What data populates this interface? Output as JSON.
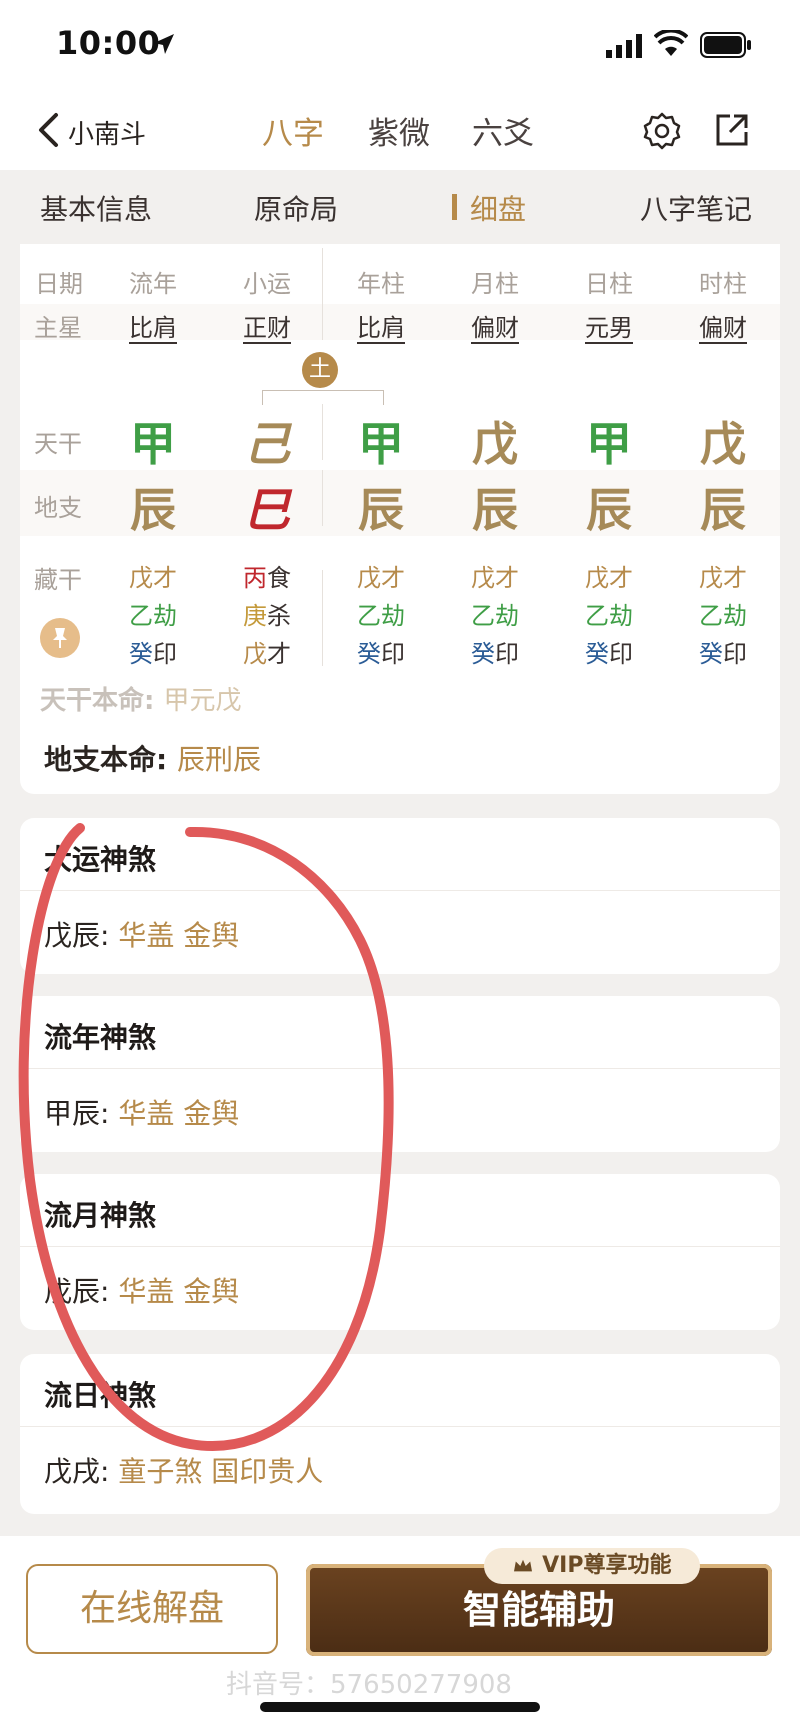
{
  "status": {
    "time": "10:00"
  },
  "nav": {
    "back_label": "小南斗",
    "tabs": [
      {
        "label": "八字"
      },
      {
        "label": "紫微"
      },
      {
        "label": "六爻"
      }
    ]
  },
  "subtabs": [
    {
      "label": "基本信息"
    },
    {
      "label": "原命局"
    },
    {
      "label": "细盘"
    },
    {
      "label": "八字笔记"
    }
  ],
  "chart": {
    "headers": [
      "日期",
      "流年",
      "小运",
      "年柱",
      "月柱",
      "日柱",
      "时柱"
    ],
    "star_label": "主星",
    "stars": [
      "比肩",
      "正财",
      "比肩",
      "偏财",
      "元男",
      "偏财"
    ],
    "badge": "土",
    "tiangan_label": "天干",
    "tiangan": [
      "甲",
      "己",
      "甲",
      "戊",
      "甲",
      "戊"
    ],
    "dizhi_label": "地支",
    "dizhi": [
      "辰",
      "巳",
      "辰",
      "辰",
      "辰",
      "辰"
    ],
    "canggan_label": "藏干",
    "canggan": [
      [
        {
          "g": "戊",
          "s": "才"
        },
        {
          "g": "乙",
          "s": "劫"
        },
        {
          "g": "癸",
          "s": "印"
        }
      ],
      [
        {
          "g": "丙",
          "s": "食"
        },
        {
          "g": "庚",
          "s": "杀"
        },
        {
          "g": "戊",
          "s": "才"
        }
      ],
      [
        {
          "g": "戊",
          "s": "才"
        },
        {
          "g": "乙",
          "s": "劫"
        },
        {
          "g": "癸",
          "s": "印"
        }
      ],
      [
        {
          "g": "戊",
          "s": "才"
        },
        {
          "g": "乙",
          "s": "劫"
        },
        {
          "g": "癸",
          "s": "印"
        }
      ],
      [
        {
          "g": "戊",
          "s": "才"
        },
        {
          "g": "乙",
          "s": "劫"
        },
        {
          "g": "癸",
          "s": "印"
        }
      ],
      [
        {
          "g": "戊",
          "s": "才"
        },
        {
          "g": "乙",
          "s": "劫"
        },
        {
          "g": "癸",
          "s": "印"
        }
      ]
    ],
    "tiangan_benming_label": "天干本命:",
    "tiangan_benming_value": "甲元戊",
    "dizhi_benming_label": "地支本命:",
    "dizhi_benming_value": "辰刑辰"
  },
  "shensha": [
    {
      "title": "大运神煞",
      "pillar": "戊辰:",
      "values": "华盖  金舆"
    },
    {
      "title": "流年神煞",
      "pillar": "甲辰:",
      "values": "华盖  金舆"
    },
    {
      "title": "流月神煞",
      "pillar": "戊辰:",
      "values": "华盖  金舆"
    },
    {
      "title": "流日神煞",
      "pillar": "戊戌:",
      "values": "童子煞  国印贵人"
    }
  ],
  "bottom": {
    "online_label": "在线解盘",
    "smart_label": "智能辅助",
    "vip_label": "VIP尊享功能",
    "watermark": "抖音号：57650277908"
  },
  "colors": {
    "accent": "#b68a4a",
    "green": "#3f9e46",
    "red": "#c0272d",
    "blue": "#2b5c96",
    "annotation": "#e05a5a"
  }
}
